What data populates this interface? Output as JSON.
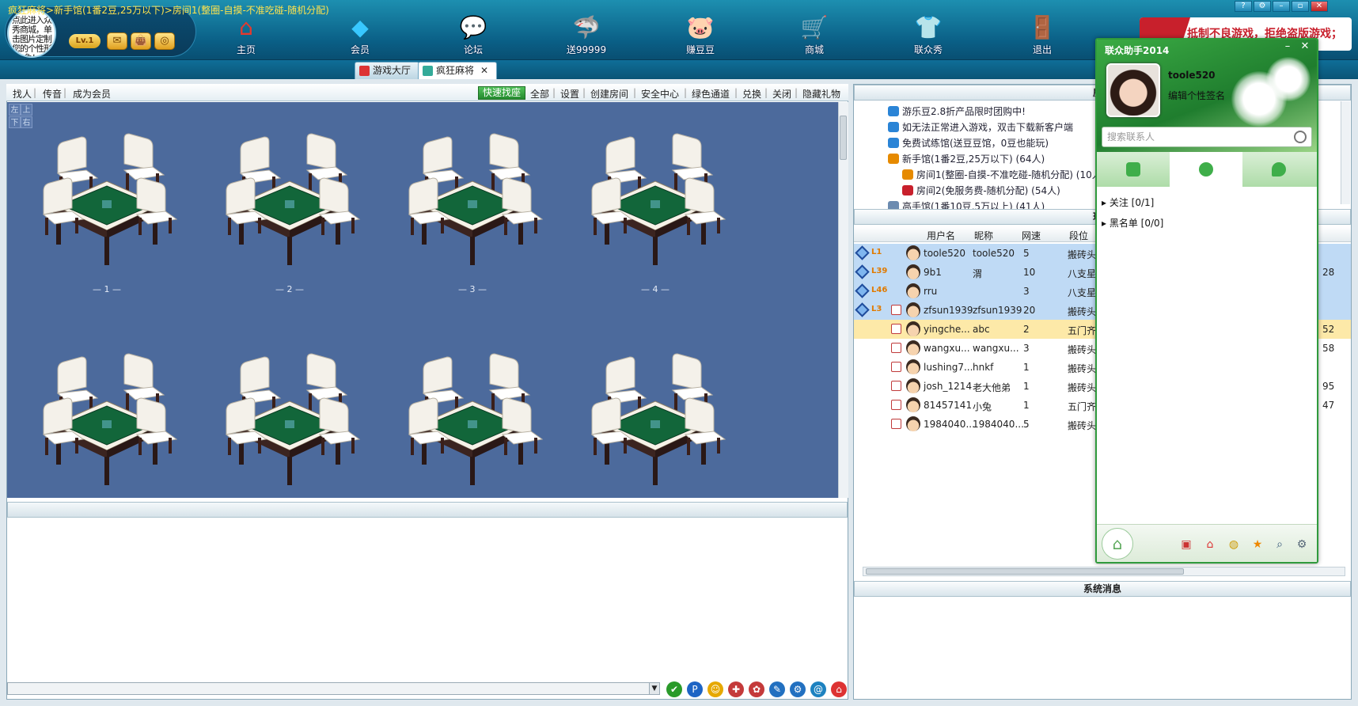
{
  "profile": {
    "avatar_prompt": "点此进入众秀商城，单击图片定制您的个性形象！",
    "level": "Lv.1"
  },
  "nav": [
    {
      "label": "主页",
      "icon": "home-icon",
      "glyph": "⌂",
      "color": "#e6392e"
    },
    {
      "label": "会员",
      "icon": "diamond-icon",
      "glyph": "◆",
      "color": "#38c8ff"
    },
    {
      "label": "论坛",
      "icon": "forum-icon",
      "glyph": "💬",
      "color": "#ffffff"
    },
    {
      "label": "送99999",
      "icon": "shark-icon",
      "glyph": "🦈",
      "color": "#7fd0ff"
    },
    {
      "label": "赚豆豆",
      "icon": "piggy-bank-icon",
      "glyph": "🐷",
      "color": "#ffc21f"
    },
    {
      "label": "商城",
      "icon": "shop-cart-icon",
      "glyph": "🛒",
      "color": "#ffffff"
    },
    {
      "label": "联众秀",
      "icon": "shirt-icon",
      "glyph": "👕",
      "color": "#ffd21f"
    },
    {
      "label": "退出",
      "icon": "exit-door-icon",
      "glyph": "🚪",
      "color": "#ffb12a"
    }
  ],
  "banner": {
    "text": "抵制不良游戏，拒绝盗版游戏；"
  },
  "breadcrumb": "疯狂麻将>新手馆(1番2豆,25万以下)>房间1(整圈-自摸-不准吃碰-随机分配)",
  "tabs": [
    {
      "label": "游戏大厅"
    },
    {
      "label": "疯狂麻将"
    }
  ],
  "toolbar": {
    "left": [
      "找人",
      "传音",
      "成为会员"
    ],
    "quick": "快速找座",
    "right": [
      "全部",
      "设置",
      "创建房间",
      "安全中心",
      "绿色通道",
      "兑换",
      "关闭",
      "隐藏礼物"
    ]
  },
  "hall": {
    "corner": [
      "左",
      "上",
      "下",
      "右"
    ],
    "tables": [
      "— 1 —",
      "— 2 —",
      "— 3 —",
      "— 4 —"
    ]
  },
  "rooms": {
    "header": "房间",
    "items": [
      "游乐豆2.8折产品限时团购中!",
      "如无法正常进入游戏，双击下载新客户端",
      "免费试练馆(送豆豆馆，0豆也能玩)",
      "新手馆(1番2豆,25万以下) (64人)",
      "房间1(整圈-自摸-不准吃碰-随机分配) (10人)",
      "房间2(免服务费-随机分配) (54人)",
      "高手馆(1番10豆,5万以上) (41人)"
    ]
  },
  "players": {
    "header": "玩家",
    "columns": [
      "用户名",
      "昵称",
      "网速",
      "段位"
    ],
    "rows": [
      {
        "level": "L1",
        "user": "toole520",
        "nick": "toole520",
        "speed": "5",
        "rank": "搬砖头",
        "extra": ""
      },
      {
        "level": "L39",
        "user": "9b1",
        "nick": "渭",
        "speed": "10",
        "rank": "八支星",
        "extra": "28"
      },
      {
        "level": "L46",
        "user": "rru",
        "nick": "",
        "speed": "3",
        "rank": "八支星",
        "extra": ""
      },
      {
        "level": "L3",
        "user": "zfsun1939",
        "nick": "zfsun1939",
        "speed": "20",
        "rank": "搬砖头",
        "extra": ""
      },
      {
        "level": "",
        "user": "yingche...",
        "nick": "abc",
        "speed": "2",
        "rank": "五门齐",
        "extra": "52"
      },
      {
        "level": "",
        "user": "wangxu...",
        "nick": "wangxu...",
        "speed": "3",
        "rank": "搬砖头",
        "extra": "58"
      },
      {
        "level": "",
        "user": "lushing7...",
        "nick": "hnkf",
        "speed": "1",
        "rank": "搬砖头",
        "extra": ""
      },
      {
        "level": "",
        "user": "josh_1214",
        "nick": "老大他弟",
        "speed": "1",
        "rank": "搬砖头",
        "extra": "95"
      },
      {
        "level": "",
        "user": "81457141",
        "nick": "小兔",
        "speed": "1",
        "rank": "五门齐",
        "extra": "47"
      },
      {
        "level": "",
        "user": "1984040...",
        "nick": "1984040...",
        "speed": "5",
        "rank": "搬砖头",
        "extra": ""
      }
    ]
  },
  "system_message": {
    "header": "系统消息"
  },
  "helper": {
    "title": "联众助手2014",
    "username": "toole520",
    "signature": "编辑个性签名",
    "search_placeholder": "搜索联系人",
    "groups": [
      "关注 [0/1]",
      "黑名单 [0/0]"
    ]
  }
}
